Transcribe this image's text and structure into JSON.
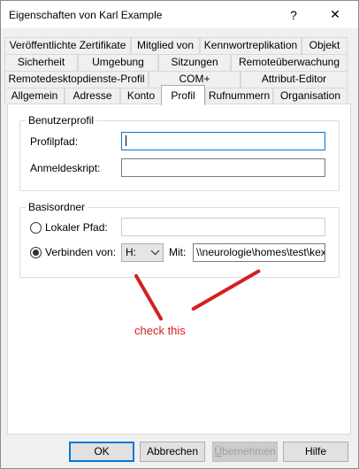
{
  "window": {
    "title": "Eigenschaften von Karl Example",
    "help_glyph": "?",
    "close_glyph": "✕",
    "help_icon": "question-mark-icon",
    "close_icon": "close-x-icon"
  },
  "tabs": {
    "row1": [
      "Veröffentlichte Zertifikate",
      "Mitglied von",
      "Kennwortreplikation",
      "Objekt"
    ],
    "row2": [
      "Sicherheit",
      "Umgebung",
      "Sitzungen",
      "Remoteüberwachung"
    ],
    "row3": [
      "Remotedesktopdienste-Profil",
      "COM+",
      "Attribut-Editor"
    ],
    "row4": [
      "Allgemein",
      "Adresse",
      "Konto",
      "Profil",
      "Rufnummern",
      "Organisation"
    ],
    "active": "Profil"
  },
  "benutzerprofil": {
    "legend": "Benutzerprofil",
    "profilpfad_label": "Profilpfad:",
    "profilpfad_value": "",
    "anmeldeskript_label": "Anmeldeskript:",
    "anmeldeskript_value": ""
  },
  "basisordner": {
    "legend": "Basisordner",
    "lokaler_pfad_label": "Lokaler Pfad:",
    "lokaler_pfad_value": "",
    "verbinden_label": "Verbinden von:",
    "drive_value": "H:",
    "mit_label": "Mit:",
    "mit_value": "\\\\neurologie\\homes\\test\\kexa",
    "selected_option": "Verbinden von"
  },
  "annotation": {
    "text": "check this",
    "color": "#d42020"
  },
  "buttons": {
    "ok": "OK",
    "abbrechen": "Abbrechen",
    "uebernehmen_underlined": "Ü",
    "uebernehmen_rest": "bernehmen",
    "hilfe": "Hilfe"
  }
}
